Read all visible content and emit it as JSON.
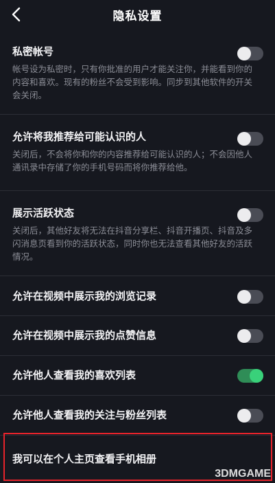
{
  "header": {
    "back_icon": "chevron-left-icon",
    "title": "隐私设置"
  },
  "settings": [
    {
      "label": "私密帐号",
      "desc": "帐号设为私密时，只有你批准的用户才能关注你，并能看到你的内容和喜欢。现有的粉丝不会受到影响。同步到其他软件的开关会关闭。",
      "on": false
    },
    {
      "label": "允许将我推荐给可能认识的人",
      "desc": "关闭后，不会将你和你的内容推荐给可能认识的人；不会因他人通讯录中存储了你的手机号码而将你推荐给他。",
      "on": false
    },
    {
      "label": "展示活跃状态",
      "desc": "关闭后，其他好友将无法在抖音分享栏、抖音开播页、抖音及多闪消息页看到你的活跃状态，同时你也无法查看其他好友的活跃情况。",
      "on": false
    },
    {
      "label": "允许在视频中展示我的浏览记录",
      "on": false
    },
    {
      "label": "允许在视频中展示我的点赞信息",
      "on": false
    },
    {
      "label": "允许他人查看我的喜欢列表",
      "on": true
    },
    {
      "label": "允许他人查看我的关注与粉丝列表",
      "on": false
    },
    {
      "label": "我可以在个人主页查看手机相册",
      "on": false
    }
  ],
  "colors": {
    "background": "#16181f",
    "toggle_on": "#39d17a",
    "highlight": "#e8232b"
  },
  "watermark": "3DMGAME"
}
